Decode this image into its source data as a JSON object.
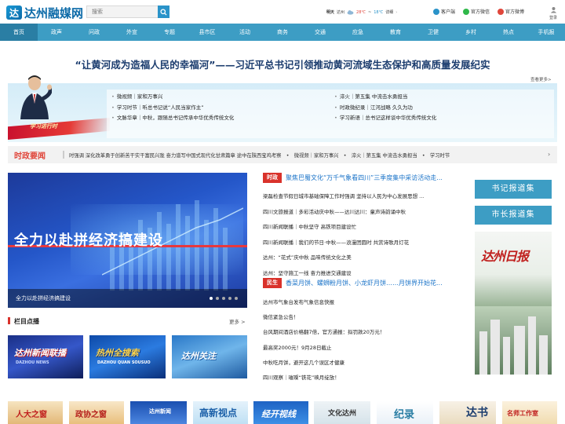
{
  "header": {
    "site_name": "达州融媒网",
    "search_placeholder": "搜索",
    "weather": {
      "day": "明天",
      "city": "达州",
      "temp_high": "28℃",
      "separator": "~",
      "temp_low": "18℃",
      "detail_link": "详细"
    },
    "links": [
      {
        "label": "客户端",
        "icon": "phone-icon",
        "color": "#2a93c9"
      },
      {
        "label": "官方微信",
        "icon": "wechat-icon",
        "color": "#2fb84a"
      },
      {
        "label": "官方微博",
        "icon": "weibo-icon",
        "color": "#e0463b"
      }
    ],
    "login": "登录"
  },
  "nav": [
    "首页",
    "政声",
    "问政",
    "外宣",
    "专题",
    "县市区",
    "活动",
    "商务",
    "交通",
    "应急",
    "教育",
    "卫健",
    "乡村",
    "热点",
    "手机报"
  ],
  "headline": "“让黄河成为造福人民的幸福河”——习近平总书记引领推动黄河流域生态保护和高质量发展纪实",
  "headline_more": "查看更多>",
  "banner": {
    "ribbon_text": "学习进行时",
    "left_items": [
      "微视频｜家和万事兴",
      "学习时节｜听总书记说“人民当家作主”",
      "文脉华章｜中秋，跟随总书记传承中华优秀传统文化"
    ],
    "right_items": [
      "淬火｜第五集 中流击水勇担当",
      "时政微纪录｜江河战略 久久为功",
      "学习新语｜总书记这样谈中华优秀传统文化"
    ]
  },
  "shizheng": {
    "label": "时政要闻",
    "ticker": "时强调 深化改革勇于创新苦干实干富民兴陇 奋力谱写中国式现代化甘肃篇章 途中在陕西宝鸡考察　•　微视频｜家和万事兴　•　淬火｜第五集 中流击水勇担当　•　学习时节",
    "arrow": "›"
  },
  "slideshow": {
    "big_text": "全力以赴拼经济搞建设",
    "caption": "全力以赴拼经济搞建设",
    "active_dot": 0,
    "dot_count": 5
  },
  "news_political": {
    "tag": "时政",
    "headline": "聚焦巴蜀文化“万千气象看四川”三季度集中采访活动走...",
    "items": [
      "梁磊检查节假日城市基础保障工作时强调 坚持以人民为中心发展思想 ...",
      "四川文旅报道｜多彩活动庆中秋——达川达川：童声诗韵诵中秋",
      "四川新闻联播｜中秋坚守 高铁项目建设忙",
      "四川新闻联播｜我们的节日·中秋——浪漫团圆时 共赏诗歌月灯花",
      "达州：“花式”庆中秋 品味传统文化之美",
      "达州：坚守施工一线 奋力推进交通建设"
    ]
  },
  "news_livelihood": {
    "tag": "民生",
    "headline": "香菜月饼、螺蛳粉月饼、小龙虾月饼……月饼界开始花...",
    "items": [
      "达州市气象台发布气象信息快报",
      "微信紧急公告！",
      "台风期间酒店价格翻7倍，官方通报：拟罚款20万元！",
      "最高奖2000元！9月28日截止",
      "中秋吃月饼，避开这几个误区才健康",
      "四川观察｜璀璨“铁花”映月绽放！"
    ]
  },
  "right_buttons": [
    "书记报道集",
    "市长报道集"
  ],
  "poster": {
    "calligraphy": "达州日报"
  },
  "lanmu": {
    "title": "栏目点播",
    "more": "更多 >",
    "thumbs": [
      {
        "title": "达州新闻联播",
        "subtitle": "DAZHOU NEWS"
      },
      {
        "title": "热州全搜索",
        "subtitle": "DAZHOU QUAN SOUSUO"
      },
      {
        "title": "达州关注",
        "subtitle": ""
      }
    ]
  },
  "bottom_strip": [
    {
      "title": "人大之窗"
    },
    {
      "title": "政协之窗"
    },
    {
      "title": "达州新闻"
    },
    {
      "title": "高新视点"
    },
    {
      "title": "经开视线"
    },
    {
      "title": "文化达州"
    },
    {
      "title": "纪录"
    },
    {
      "title": "达书"
    },
    {
      "title": "名师工作室"
    }
  ]
}
